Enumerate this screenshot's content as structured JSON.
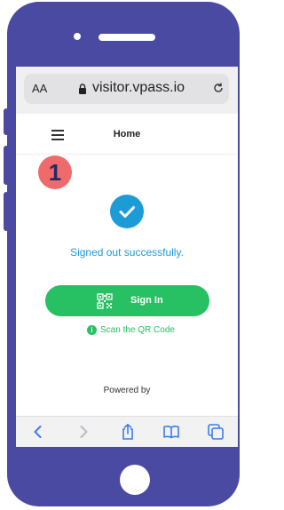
{
  "browser": {
    "text_size_label": "AA",
    "url": "visitor.vpass.io"
  },
  "header": {
    "title": "Home"
  },
  "annotation": {
    "step_number": "1"
  },
  "main": {
    "status_message": "Signed out successfully.",
    "signin_label": "Sign In",
    "scan_label": "Scan the QR Code",
    "powered_by": "Powered by"
  },
  "colors": {
    "phone_frame": "#4a4aa3",
    "accent_blue": "#1d9bd7",
    "accent_green": "#27c063",
    "badge_red": "#ef6b6b",
    "toolbar_icon": "#3b7bf5"
  },
  "icons": {
    "menu": "hamburger-icon",
    "status": "checkmark-icon",
    "qr": "qr-code-icon",
    "info": "info-icon",
    "reload": "reload-icon",
    "lock": "lock-icon",
    "toolbar": [
      "back-icon",
      "forward-icon",
      "share-icon",
      "bookmarks-icon",
      "tabs-icon"
    ]
  }
}
